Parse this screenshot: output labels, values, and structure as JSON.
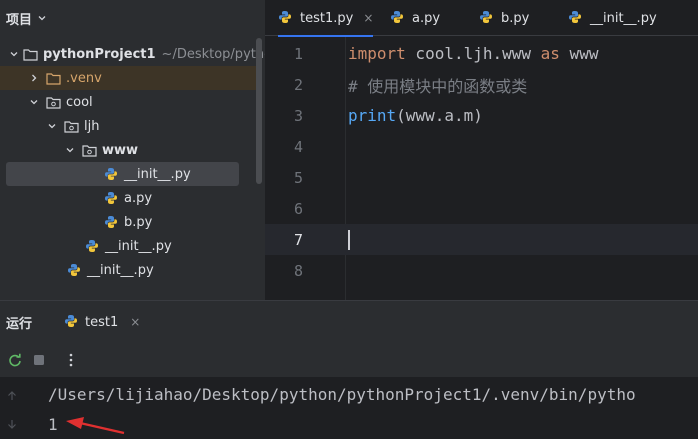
{
  "project_panel": {
    "title": "项目",
    "tree": [
      {
        "label": "pythonProject1",
        "hint": "~/Desktop/pytho"
      },
      {
        "label": ".venv"
      },
      {
        "label": "cool"
      },
      {
        "label": "ljh"
      },
      {
        "label": "www"
      },
      {
        "label": "__init__.py"
      },
      {
        "label": "a.py"
      },
      {
        "label": "b.py"
      },
      {
        "label": "__init__.py"
      },
      {
        "label": "__init__.py"
      }
    ]
  },
  "editor": {
    "tabs": [
      {
        "label": "test1.py",
        "close": "×"
      },
      {
        "label": "a.py"
      },
      {
        "label": "b.py"
      },
      {
        "label": "__init__.py"
      }
    ],
    "line_numbers": [
      "1",
      "2",
      "3",
      "4",
      "5",
      "6",
      "7",
      "8"
    ],
    "code": {
      "l1_kw": "import",
      "l1_rest": " cool.ljh.www ",
      "l1_kw2": "as",
      "l1_alias": " www",
      "l2_comment": "# 使用模块中的函数或类",
      "l3_fn": "print",
      "l3_rest": "(www.a.m)"
    }
  },
  "run_panel": {
    "title": "运行",
    "tab_label": "test1",
    "tab_close": "×",
    "console": {
      "path_line": "/Users/lijiahao/Desktop/python/pythonProject1/.venv/bin/pytho",
      "output_line": "1"
    }
  },
  "colors": {
    "accent": "#3574f0",
    "annotation_arrow": "#e03030"
  }
}
